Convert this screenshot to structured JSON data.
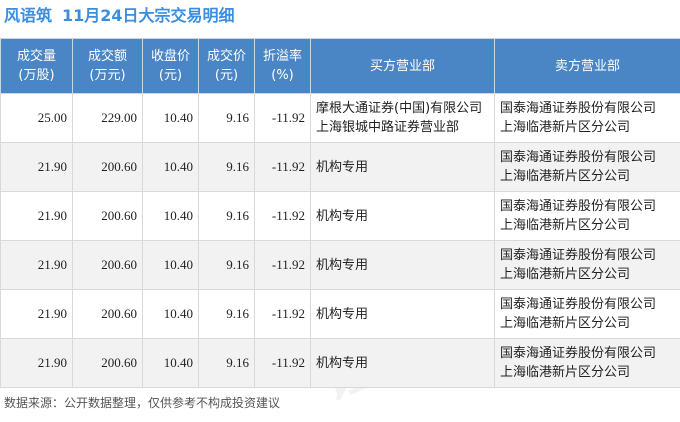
{
  "title": {
    "stock_name": "风语筑",
    "heading": "11月24日大宗交易明细"
  },
  "table": {
    "headers": [
      {
        "line1": "成交量",
        "line2": "(万股)"
      },
      {
        "line1": "成交额",
        "line2": "(万元)"
      },
      {
        "line1": "收盘价",
        "line2": "(元)"
      },
      {
        "line1": "成交价",
        "line2": "(元)"
      },
      {
        "line1": "折溢率",
        "line2": "(%)"
      },
      {
        "line1": "买方营业部",
        "line2": ""
      },
      {
        "line1": "卖方营业部",
        "line2": ""
      }
    ],
    "rows": [
      {
        "volume": "25.00",
        "amount": "229.00",
        "close": "10.40",
        "price": "9.16",
        "rate": "-11.92",
        "buyer": [
          "摩根大通证券(中国)有限公司",
          "上海银城中路证券营业部"
        ],
        "seller": [
          "国泰海通证券股份有限公司",
          "上海临港新片区分公司"
        ]
      },
      {
        "volume": "21.90",
        "amount": "200.60",
        "close": "10.40",
        "price": "9.16",
        "rate": "-11.92",
        "buyer": [
          "机构专用"
        ],
        "seller": [
          "国泰海通证券股份有限公司",
          "上海临港新片区分公司"
        ]
      },
      {
        "volume": "21.90",
        "amount": "200.60",
        "close": "10.40",
        "price": "9.16",
        "rate": "-11.92",
        "buyer": [
          "机构专用"
        ],
        "seller": [
          "国泰海通证券股份有限公司",
          "上海临港新片区分公司"
        ]
      },
      {
        "volume": "21.90",
        "amount": "200.60",
        "close": "10.40",
        "price": "9.16",
        "rate": "-11.92",
        "buyer": [
          "机构专用"
        ],
        "seller": [
          "国泰海通证券股份有限公司",
          "上海临港新片区分公司"
        ]
      },
      {
        "volume": "21.90",
        "amount": "200.60",
        "close": "10.40",
        "price": "9.16",
        "rate": "-11.92",
        "buyer": [
          "机构专用"
        ],
        "seller": [
          "国泰海通证券股份有限公司",
          "上海临港新片区分公司"
        ]
      },
      {
        "volume": "21.90",
        "amount": "200.60",
        "close": "10.40",
        "price": "9.16",
        "rate": "-11.92",
        "buyer": [
          "机构专用"
        ],
        "seller": [
          "国泰海通证券股份有限公司",
          "上海临港新片区分公司"
        ]
      }
    ]
  },
  "footer": {
    "source": "数据来源：公开数据整理，仅供参考不构成投资建议"
  },
  "watermark": {
    "text": "证券之星"
  },
  "colors": {
    "title": "#3a8ee0",
    "header_bg": "#4a86c5",
    "rate_text": "#2a9a3a",
    "alt_row": "#f2f2f2"
  }
}
